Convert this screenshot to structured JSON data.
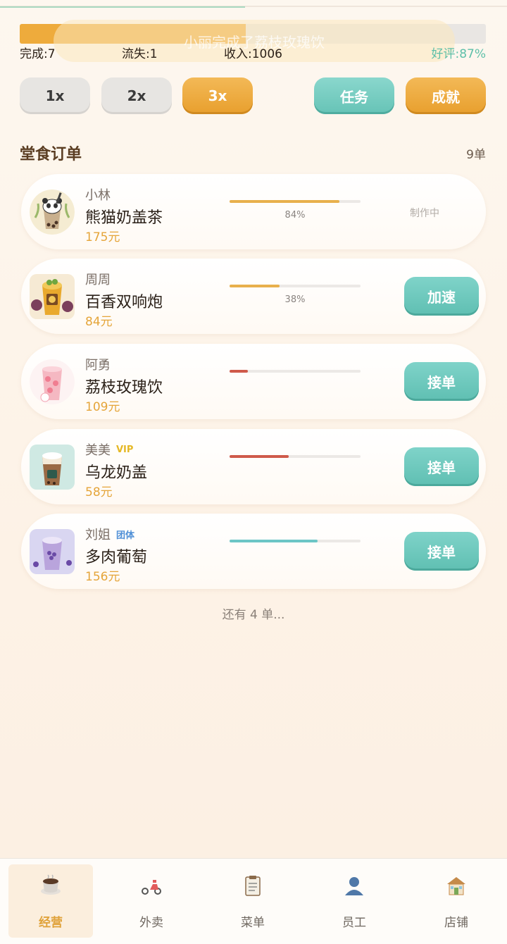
{
  "progress": {
    "fraction": 0.485,
    "toast": "小丽完成了荔枝玫瑰饮"
  },
  "stats": {
    "done": "完成:7",
    "lost": "流失:1",
    "income": "收入:1006",
    "rating": "好评:87%"
  },
  "speed_buttons": [
    {
      "label": "1x",
      "active": false
    },
    {
      "label": "2x",
      "active": false
    },
    {
      "label": "3x",
      "active": true
    }
  ],
  "actions": {
    "task": "任务",
    "achievement": "成就"
  },
  "section": {
    "title": "堂食订单",
    "count": "9单"
  },
  "orders": [
    {
      "customer": "小林",
      "tag": "",
      "dish": "熊猫奶盖茶",
      "price": "175元",
      "progress": 0.84,
      "progress_label": "84%",
      "bar_color": "#e8b04c",
      "status": "制作中",
      "button": ""
    },
    {
      "customer": "周周",
      "tag": "",
      "dish": "百香双响炮",
      "price": "84元",
      "progress": 0.38,
      "progress_label": "38%",
      "bar_color": "#e8b04c",
      "status": "",
      "button": "加速"
    },
    {
      "customer": "阿勇",
      "tag": "",
      "dish": "荔枝玫瑰饮",
      "price": "109元",
      "progress": 0.14,
      "progress_label": "",
      "bar_color": "#cf5a4a",
      "status": "",
      "button": "接单"
    },
    {
      "customer": "美美",
      "tag": "VIP",
      "dish": "乌龙奶盖",
      "price": "58元",
      "progress": 0.45,
      "progress_label": "",
      "bar_color": "#cf5a4a",
      "status": "",
      "button": "接单"
    },
    {
      "customer": "刘姐",
      "tag": "团体",
      "dish": "多肉葡萄",
      "price": "156元",
      "progress": 0.67,
      "progress_label": "",
      "bar_color": "#6cc6c6",
      "status": "",
      "button": "接单"
    }
  ],
  "more": "还有 4 单...",
  "nav": [
    {
      "label": "经营",
      "icon": "coffee-cup-icon",
      "active": true
    },
    {
      "label": "外卖",
      "icon": "scooter-icon",
      "active": false
    },
    {
      "label": "菜单",
      "icon": "clipboard-icon",
      "active": false
    },
    {
      "label": "员工",
      "icon": "person-icon",
      "active": false
    },
    {
      "label": "店铺",
      "icon": "shop-icon",
      "active": false
    }
  ]
}
